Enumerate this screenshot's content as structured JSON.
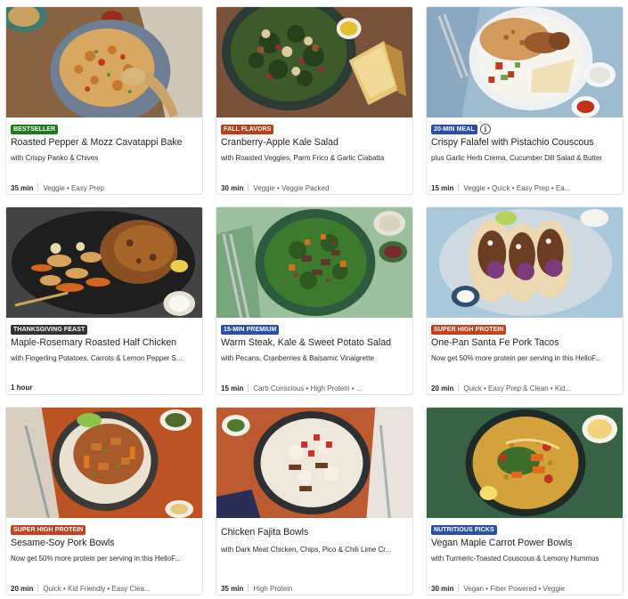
{
  "colors": {
    "badge_green": "#1f7a1f",
    "badge_orange": "#b5421a",
    "badge_blue": "#2b4fa5",
    "badge_dark": "#333333",
    "badge_red": "#c4421f"
  },
  "recipes": [
    {
      "badge": "BESTSELLER",
      "badge_color": "#1f7a1f",
      "title": "Roasted Pepper & Mozz Cavatappi Bake",
      "subtitle": "with Crispy Panko & Chives",
      "time": "35 min",
      "tags": "Veggie • Easy Prep",
      "image": "cavatappi-bake-photo"
    },
    {
      "badge": "FALL FLAVORS",
      "badge_color": "#b5421a",
      "title": "Cranberry-Apple Kale Salad",
      "subtitle": "with Roasted Veggies, Parm Frico & Garlic Ciabatta",
      "time": "30 min",
      "tags": "Veggie • Veggie Packed",
      "image": "kale-salad-photo"
    },
    {
      "badge": "20-MIN MEAL",
      "badge_color": "#2b4fa5",
      "has_info_icon": true,
      "title": "Crispy Falafel with Pistachio Couscous",
      "subtitle": "plus Garlic Herb Crema, Cucumber Dill Salad & Butter",
      "time": "15 min",
      "tags": "Veggie • Quick • Easy Prep • Ea...",
      "image": "falafel-couscous-photo"
    },
    {
      "badge": "THANKSGIVING FEAST",
      "badge_color": "#333333",
      "title": "Maple-Rosemary Roasted Half Chicken",
      "subtitle": "with Fingerling Potatoes, Carrots & Lemon Pepper S...",
      "time": "1 hour",
      "tags": "",
      "image": "roasted-chicken-photo"
    },
    {
      "badge": "15-MIN PREMIUM",
      "badge_color": "#2b4fa5",
      "title": "Warm Steak, Kale & Sweet Potato Salad",
      "subtitle": "with Pecans, Cranberries & Balsamic Vinaigrette",
      "time": "15 min",
      "tags": "Carb Conscious • High Protein • ...",
      "image": "steak-salad-photo"
    },
    {
      "badge": "SUPER HIGH PROTEIN",
      "badge_color": "#c4421f",
      "title": "One-Pan Santa Fe Pork Tacos",
      "subtitle": "Now get 50% more protein per serving in this HelloF...",
      "time": "20 min",
      "tags": "Quick • Easy Prep & Clean • Kid...",
      "image": "pork-tacos-photo"
    },
    {
      "badge": "SUPER HIGH PROTEIN",
      "badge_color": "#c4421f",
      "title": "Sesame-Soy Pork Bowls",
      "subtitle": "Now get 50% more protein per serving in this HelloF...",
      "time": "20 min",
      "tags": "Quick • Kid Friendly • Easy Clea...",
      "image": "pork-bowls-photo"
    },
    {
      "badge": "",
      "badge_color": "",
      "title": "Chicken Fajita Bowls",
      "subtitle": "with Dark Meat Chicken, Chips, Pico & Chili Lime Cr...",
      "time": "35 min",
      "tags": "High Protein",
      "image": "fajita-bowls-photo"
    },
    {
      "badge": "NUTRITIOUS PICKS",
      "badge_color": "#2b4fa5",
      "title": "Vegan Maple Carrot Power Bowls",
      "subtitle": "with Turmeric-Toasted Couscous & Lemony Hummus",
      "time": "30 min",
      "tags": "Vegan • Fiber Powered • Veggie",
      "image": "power-bowls-photo"
    }
  ]
}
